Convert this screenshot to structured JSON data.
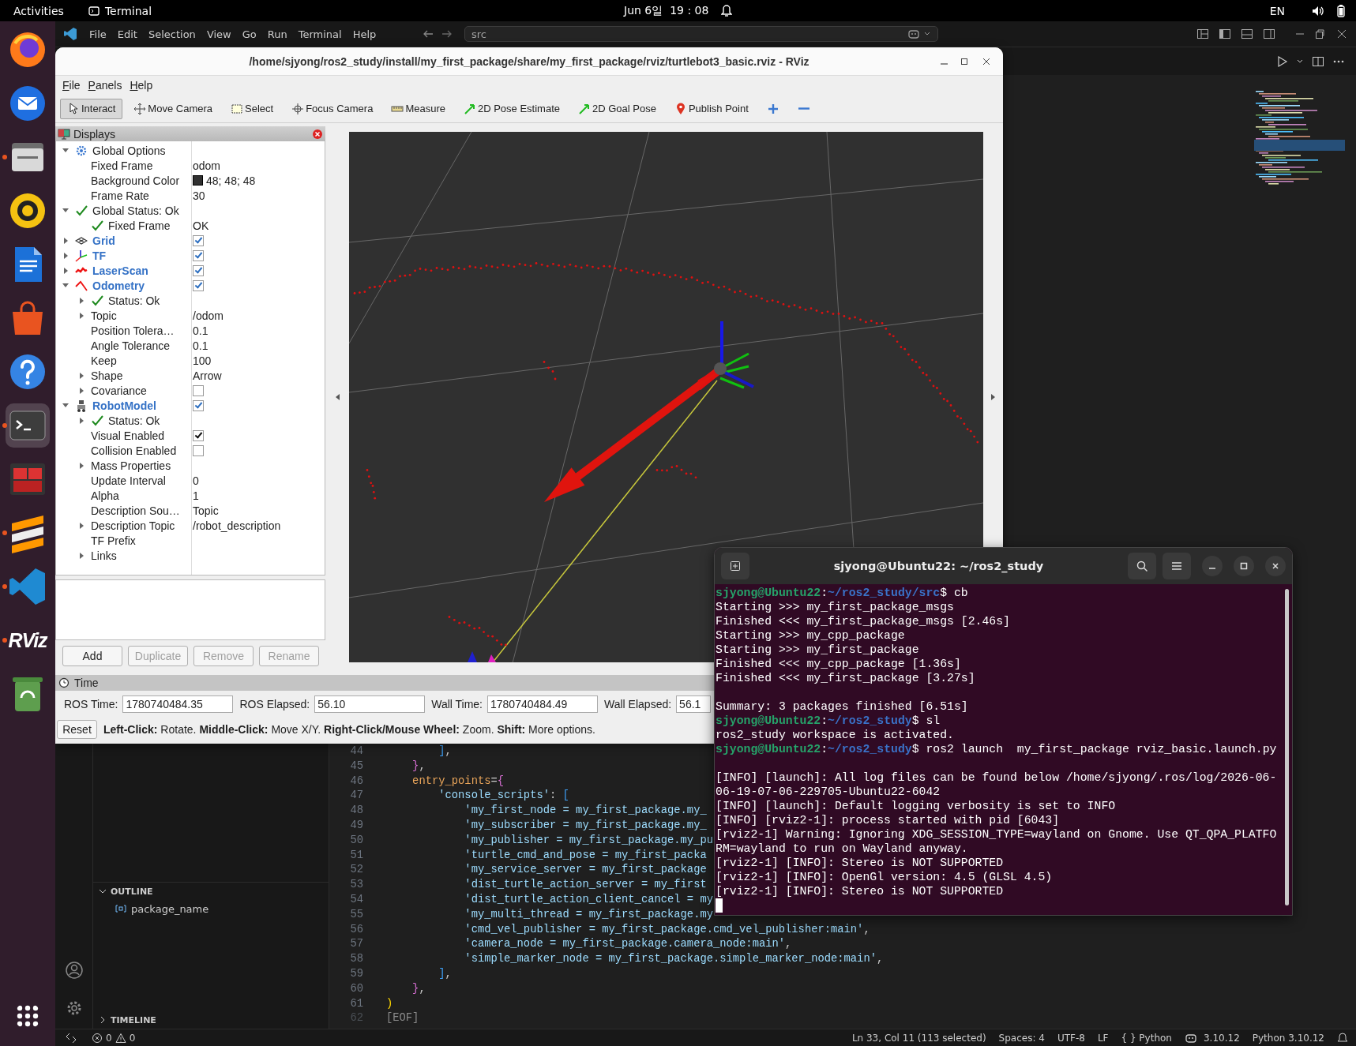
{
  "top_bar": {
    "activities": "Activities",
    "app_name": "Terminal",
    "clock": "Jun 6일  19 : 08",
    "input_source": "EN"
  },
  "dock": [
    {
      "kind": "browser",
      "running": false,
      "selected": false
    },
    {
      "kind": "mail",
      "running": false,
      "selected": false
    },
    {
      "kind": "files",
      "running": true,
      "selected": false
    },
    {
      "kind": "music",
      "running": false,
      "selected": false
    },
    {
      "kind": "writer",
      "running": false,
      "selected": false
    },
    {
      "kind": "store",
      "running": false,
      "selected": false
    },
    {
      "kind": "help",
      "running": false,
      "selected": false
    },
    {
      "kind": "terminal",
      "running": true,
      "selected": true
    },
    {
      "kind": "monitor",
      "running": false,
      "selected": false
    },
    {
      "kind": "layers",
      "running": true,
      "selected": false
    },
    {
      "kind": "code",
      "running": true,
      "selected": false
    },
    {
      "kind": "rviz",
      "label": "RViz",
      "running": true,
      "selected": false
    },
    {
      "kind": "trash",
      "running": false,
      "selected": false
    }
  ],
  "vscode": {
    "menu": [
      "File",
      "Edit",
      "Selection",
      "View",
      "Go",
      "Run",
      "Terminal",
      "Help"
    ],
    "search_text": "src",
    "outline": {
      "title": "OUTLINE",
      "items": [
        "package_name"
      ]
    },
    "timeline": {
      "title": "TIMELINE"
    },
    "editor": {
      "lines": [
        {
          "number": "44",
          "tokens": [
            {
              "text": "        ]",
              "kind": "bracket"
            },
            {
              "text": ",",
              "kind": "plain"
            }
          ]
        },
        {
          "number": "45",
          "tokens": [
            {
              "text": "    }",
              "kind": "brace"
            },
            {
              "text": ",",
              "kind": "plain"
            }
          ]
        },
        {
          "number": "46",
          "tokens": [
            {
              "text": "    entry_points",
              "kind": "key"
            },
            {
              "text": "=",
              "kind": "plain"
            },
            {
              "text": "{",
              "kind": "brace"
            }
          ]
        },
        {
          "number": "47",
          "tokens": [
            {
              "text": "        'console_scripts'",
              "kind": "string"
            },
            {
              "text": ": ",
              "kind": "plain"
            },
            {
              "text": "[",
              "kind": "bracket"
            }
          ]
        },
        {
          "number": "48",
          "tokens": [
            {
              "text": "            'my_first_node = my_first_package.my_",
              "kind": "string"
            }
          ]
        },
        {
          "number": "49",
          "tokens": [
            {
              "text": "            'my_subscriber = my_first_package.my_",
              "kind": "string"
            }
          ]
        },
        {
          "number": "50",
          "tokens": [
            {
              "text": "            'my_publisher = my_first_package.my_pu",
              "kind": "string"
            }
          ]
        },
        {
          "number": "51",
          "tokens": [
            {
              "text": "            'turtle_cmd_and_pose = my_first_packa",
              "kind": "string"
            }
          ]
        },
        {
          "number": "52",
          "tokens": [
            {
              "text": "            'my_service_server = my_first_package",
              "kind": "string"
            }
          ]
        },
        {
          "number": "53",
          "tokens": [
            {
              "text": "            'dist_turtle_action_server = my_first",
              "kind": "string"
            }
          ]
        },
        {
          "number": "54",
          "tokens": [
            {
              "text": "            'dist_turtle_action_client_cancel = my",
              "kind": "string"
            }
          ]
        },
        {
          "number": "55",
          "tokens": [
            {
              "text": "            'my_multi_thread = my_first_package.my",
              "kind": "string"
            }
          ]
        },
        {
          "number": "56",
          "tokens": [
            {
              "text": "            'cmd_vel_publisher = my_first_package.cmd_vel_publisher:main'",
              "kind": "string"
            },
            {
              "text": ",",
              "kind": "plain"
            }
          ]
        },
        {
          "number": "57",
          "tokens": [
            {
              "text": "            'camera_node = my_first_package.camera_node:main'",
              "kind": "string"
            },
            {
              "text": ",",
              "kind": "plain"
            }
          ]
        },
        {
          "number": "58",
          "tokens": [
            {
              "text": "            'simple_marker_node = my_first_package.simple_marker_node:main'",
              "kind": "string"
            },
            {
              "text": ",",
              "kind": "plain"
            }
          ]
        },
        {
          "number": "59",
          "tokens": [
            {
              "text": "        ]",
              "kind": "bracket"
            },
            {
              "text": ",",
              "kind": "plain"
            }
          ]
        },
        {
          "number": "60",
          "tokens": [
            {
              "text": "    }",
              "kind": "brace"
            },
            {
              "text": ",",
              "kind": "plain"
            }
          ]
        },
        {
          "number": "61",
          "tokens": [
            {
              "text": ")",
              "kind": "paren"
            }
          ]
        },
        {
          "number": "62",
          "tokens": [
            {
              "text": "[EOF]",
              "kind": "eof"
            }
          ]
        }
      ]
    },
    "status_bar": {
      "errors": "0",
      "warnings": "0",
      "items": [
        "Ln 33, Col 11 (113 selected)",
        "Spaces: 4",
        "UTF-8",
        "LF",
        "{ } Python"
      ],
      "python_version": "3.10.12",
      "interpreter": "Python 3.10.12"
    }
  },
  "rviz": {
    "title": "/home/sjyong/ros2_study/install/my_first_package/share/my_first_package/rviz/turtlebot3_basic.rviz - RViz",
    "menu": [
      "File",
      "Panels",
      "Help"
    ],
    "tools": [
      {
        "kind": "interact",
        "label": "Interact",
        "selected": true
      },
      {
        "kind": "move_camera",
        "label": "Move Camera",
        "selected": false
      },
      {
        "kind": "select",
        "label": "Select",
        "selected": false
      },
      {
        "kind": "focus_camera",
        "label": "Focus Camera",
        "selected": false
      },
      {
        "kind": "measure",
        "label": "Measure",
        "selected": false
      },
      {
        "kind": "pose_estimate",
        "label": "2D Pose Estimate",
        "selected": false
      },
      {
        "kind": "goal_pose",
        "label": "2D Goal Pose",
        "selected": false
      },
      {
        "kind": "publish_point",
        "label": "Publish Point",
        "selected": false
      },
      {
        "kind": "add",
        "selected": false
      },
      {
        "kind": "remove",
        "selected": false
      }
    ],
    "displays": {
      "title": "Displays",
      "items": [
        {
          "kind": "options",
          "label": "Global Options",
          "expanded": true,
          "children": [
            {
              "kind": "property",
              "label": "Fixed Frame",
              "value": "odom"
            },
            {
              "kind": "property",
              "label": "Background Color",
              "value": "48; 48; 48",
              "color": "#303030"
            },
            {
              "kind": "property",
              "label": "Frame Rate",
              "value": "30"
            }
          ]
        },
        {
          "kind": "status",
          "label": "Global Status: Ok",
          "expanded": true,
          "children": [
            {
              "kind": "status",
              "label": "Fixed Frame",
              "value": "OK"
            }
          ]
        },
        {
          "kind": "grid",
          "label": "Grid",
          "expanded": false,
          "checked": true
        },
        {
          "kind": "tf",
          "label": "TF",
          "expanded": false,
          "checked": true
        },
        {
          "kind": "laser_scan",
          "label": "LaserScan",
          "expanded": false,
          "checked": true
        },
        {
          "kind": "odometry",
          "label": "Odometry",
          "expanded": true,
          "checked": true,
          "children": [
            {
              "kind": "status",
              "label": "Status: Ok",
              "expanded": false
            },
            {
              "kind": "property",
              "label": "Topic",
              "value": "/odom",
              "expanded": false
            },
            {
              "kind": "property",
              "label": "Position Tolera…",
              "value": "0.1"
            },
            {
              "kind": "property",
              "label": "Angle Tolerance",
              "value": "0.1"
            },
            {
              "kind": "property",
              "label": "Keep",
              "value": "100"
            },
            {
              "kind": "property",
              "label": "Shape",
              "value": "Arrow",
              "expanded": false
            },
            {
              "kind": "property",
              "label": "Covariance",
              "checked": false,
              "expanded": false
            }
          ]
        },
        {
          "kind": "robot_model",
          "label": "RobotModel",
          "expanded": true,
          "checked": true,
          "children": [
            {
              "kind": "status",
              "label": "Status: Ok",
              "expanded": false
            },
            {
              "kind": "property",
              "label": "Visual Enabled",
              "checked": true
            },
            {
              "kind": "property",
              "label": "Collision Enabled",
              "checked": false
            },
            {
              "kind": "property",
              "label": "Mass Properties",
              "expanded": false
            },
            {
              "kind": "property",
              "label": "Update Interval",
              "value": "0"
            },
            {
              "kind": "property",
              "label": "Alpha",
              "value": "1"
            },
            {
              "kind": "property",
              "label": "Description Sou…",
              "value": "Topic"
            },
            {
              "kind": "property",
              "label": "Description Topic",
              "value": "/robot_description",
              "expanded": false
            },
            {
              "kind": "property",
              "label": "TF Prefix"
            },
            {
              "kind": "property",
              "label": "Links",
              "expanded": false
            }
          ]
        }
      ]
    },
    "buttons": [
      {
        "label": "Add",
        "disabled": false
      },
      {
        "label": "Duplicate",
        "disabled": true
      },
      {
        "label": "Remove",
        "disabled": true
      },
      {
        "label": "Rename",
        "disabled": true
      }
    ],
    "time": {
      "title": "Time",
      "fields": [
        {
          "label": "ROS Time:",
          "value": "1780740484.35"
        },
        {
          "label": "ROS Elapsed:",
          "value": "56.10"
        },
        {
          "label": "Wall Time:",
          "value": "1780740484.49"
        },
        {
          "label": "Wall Elapsed:",
          "value": "56.1"
        }
      ]
    },
    "reset": "Reset",
    "hint": "**Left-Click:** Rotate. **Middle-Click:** Move X/Y. **Right-Click/Mouse Wheel:** Zoom. **Shift:** More options."
  },
  "terminal": {
    "title": "sjyong@Ubuntu22: ~/ros2_study",
    "lines": [
      {
        "kind": "prompt",
        "user": "sjyong@Ubuntu22",
        "sep": ":",
        "path": "~/ros2_study/src",
        "command": "$ cb"
      },
      {
        "kind": "output",
        "text": "Starting >>> my_first_package_msgs"
      },
      {
        "kind": "output",
        "text": "Finished <<< my_first_package_msgs [2.46s]"
      },
      {
        "kind": "output",
        "text": "Starting >>> my_cpp_package"
      },
      {
        "kind": "output",
        "text": "Starting >>> my_first_package"
      },
      {
        "kind": "output",
        "text": "Finished <<< my_cpp_package [1.36s]"
      },
      {
        "kind": "output",
        "text": "Finished <<< my_first_package [3.27s]"
      },
      {
        "kind": "blank"
      },
      {
        "kind": "output",
        "text": "Summary: 3 packages finished [6.51s]"
      },
      {
        "kind": "prompt",
        "user": "sjyong@Ubuntu22",
        "sep": ":",
        "path": "~/ros2_study",
        "command": "$ sl"
      },
      {
        "kind": "output",
        "text": "ros2_study workspace is activated."
      },
      {
        "kind": "prompt",
        "user": "sjyong@Ubuntu22",
        "sep": ":",
        "path": "~/ros2_study",
        "command": "$ ros2 launch  my_first_package rviz_basic.launch.py"
      },
      {
        "kind": "blank"
      },
      {
        "kind": "output",
        "text": "[INFO] [launch]: All log files can be found below /home/sjyong/.ros/log/2026-06-"
      },
      {
        "kind": "output",
        "text": "06-19-07-06-229705-Ubuntu22-6042"
      },
      {
        "kind": "output",
        "text": "[INFO] [launch]: Default logging verbosity is set to INFO"
      },
      {
        "kind": "output",
        "text": "[INFO] [rviz2-1]: process started with pid [6043]"
      },
      {
        "kind": "output",
        "text": "[rviz2-1] Warning: Ignoring XDG_SESSION_TYPE=wayland on Gnome. Use QT_QPA_PLATFO"
      },
      {
        "kind": "output",
        "text": "RM=wayland to run on Wayland anyway."
      },
      {
        "kind": "output",
        "text": "[rviz2-1] [INFO]: Stereo is NOT SUPPORTED"
      },
      {
        "kind": "output",
        "text": "[rviz2-1] [INFO]: OpenGl version: 4.5 (GLSL 4.5)"
      },
      {
        "kind": "output",
        "text": "[rviz2-1] [INFO]: Stereo is NOT SUPPORTED"
      },
      {
        "kind": "cursor"
      }
    ]
  }
}
